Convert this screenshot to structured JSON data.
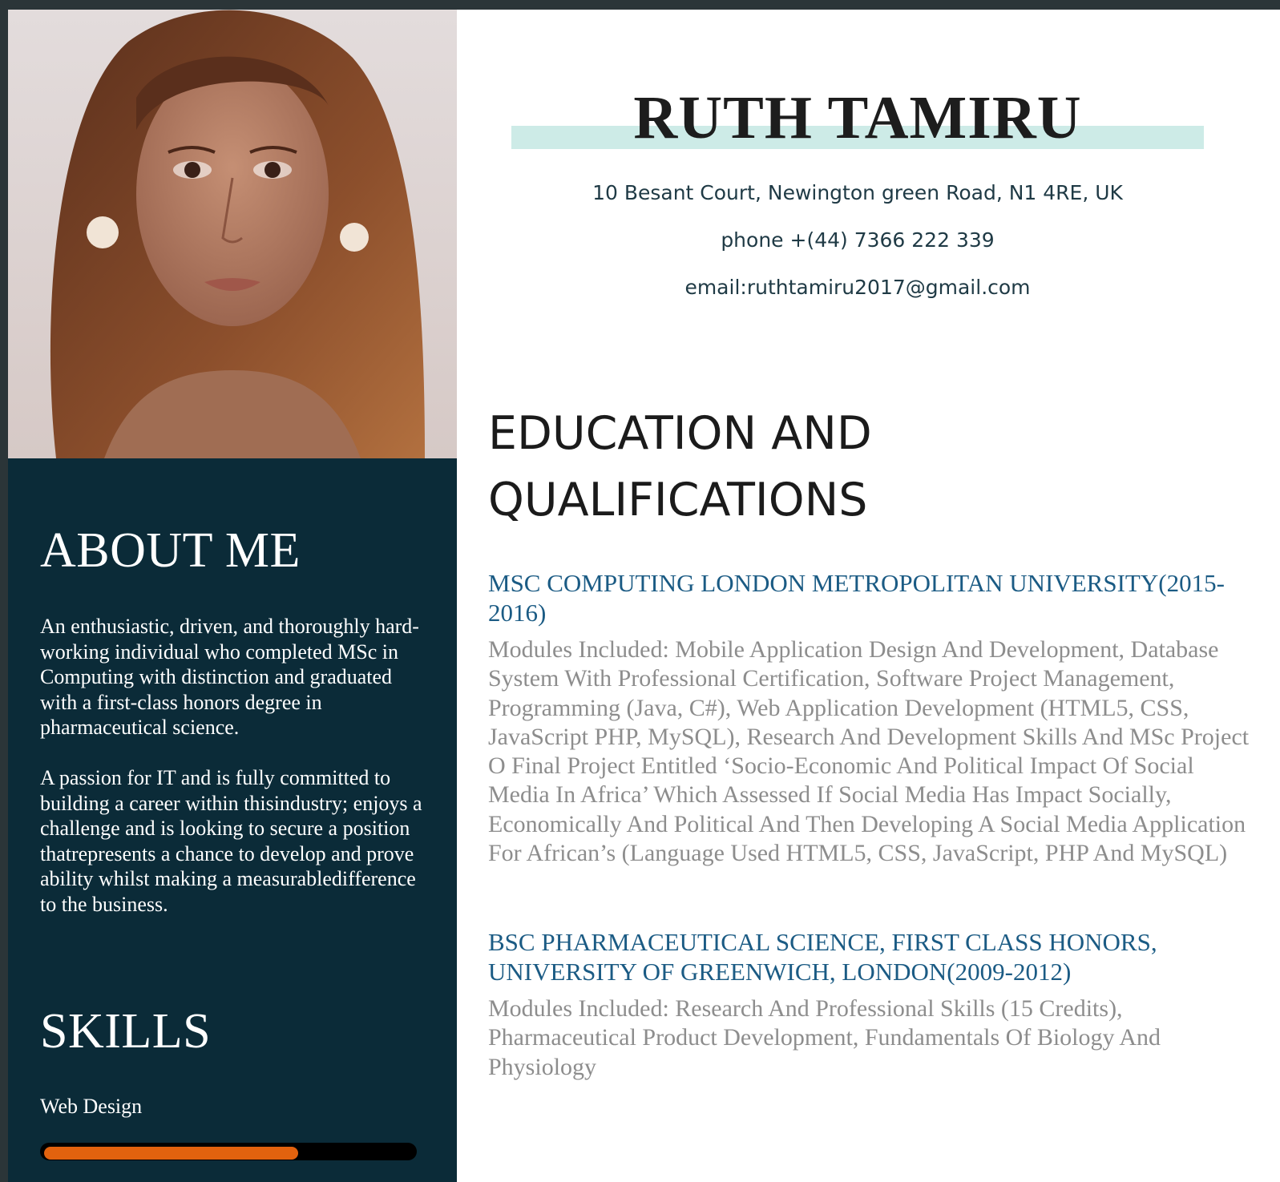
{
  "profile": {
    "name": "RUTH TAMIRU",
    "address": "10 Besant Court, Newington green Road, N1 4RE, UK",
    "phone": "phone +(44) 7366 222 339",
    "email": "email:ruthtamiru2017@gmail.com"
  },
  "sidebar": {
    "about_heading": "ABOUT ME",
    "about_paragraphs": [
      "An enthusiastic, driven, and thoroughly hard-working individual who completed MSc in Computing with distinction and graduated with a first-class honors degree in pharmaceutical science.",
      "A passion for IT and is fully committed to building a career within thisindustry; enjoys a challenge and is looking to secure a position thatrepresents a chance to develop and prove ability whilst making a measurabledifference to the business."
    ],
    "skills_heading": "SKILLS",
    "skills": [
      {
        "label": "Web Design",
        "level": 0.69
      }
    ]
  },
  "education": {
    "heading": "EDUCATION AND QUALIFICATIONS",
    "items": [
      {
        "title": "MSC COMPUTING LONDON METROPOLITAN UNIVERSITY(2015-2016)",
        "modules": "Modules Included: Mobile Application Design And Development, Database System With Professional Certification, Software Project Management, Programming (Java, C#), Web Application Development (HTML5, CSS, JavaScript PHP, MySQL), Research And Development Skills And MSc Project O Final Project Entitled ‘Socio-Economic And Political Impact Of Social Media In Africa’ Which Assessed If Social Media Has Impact Socially, Economically And Political And Then Developing A Social Media Application For African’s (Language Used HTML5, CSS, JavaScript, PHP And MySQL)"
      },
      {
        "title": "BSC PHARMACEUTICAL SCIENCE, FIRST CLASS HONORS, UNIVERSITY OF GREENWICH, LONDON(2009-2012)",
        "modules": "Modules Included: Research And Professional Skills (15 Credits), Pharmaceutical Product Development, Fundamentals Of Biology And Physiology"
      }
    ]
  },
  "colors": {
    "sidebar_bg": "#0b2b38",
    "name_highlight": "#cdebe7",
    "qualification_title": "#1b5b84",
    "module_text": "#8d8d8d",
    "skill_fill": "#e2620e"
  }
}
